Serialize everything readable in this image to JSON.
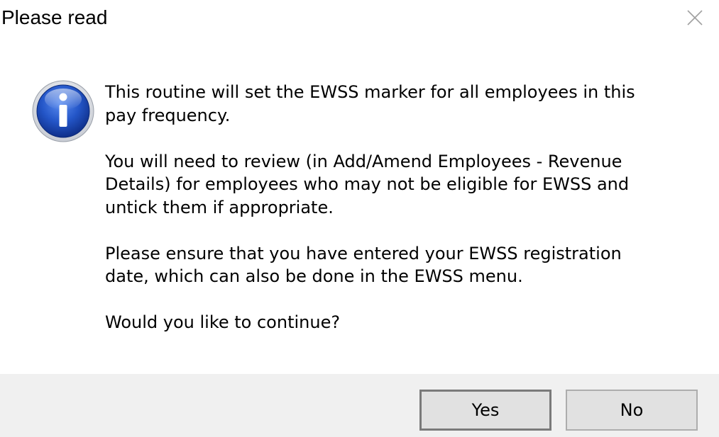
{
  "window": {
    "title": "Please read",
    "close_icon": "close-icon"
  },
  "icon": "info-icon",
  "message": {
    "paragraph1": [
      "This routine will set the EWSS marker for all employees in this",
      "pay frequency."
    ],
    "paragraph2": [
      "You will need to review (in Add/Amend Employees - Revenue",
      "Details) for employees who may not be eligible for EWSS and",
      "untick them if appropriate."
    ],
    "paragraph3": [
      "Please ensure that you have entered your EWSS registration",
      "date, which can also be done in the EWSS menu."
    ],
    "question": "Would you like to continue?"
  },
  "buttons": {
    "yes_label": "Yes",
    "no_label": "No"
  },
  "colors": {
    "footer_bg": "#f0f0f0",
    "button_bg": "#e1e1e1",
    "icon_blue": "#1e4fc0"
  }
}
